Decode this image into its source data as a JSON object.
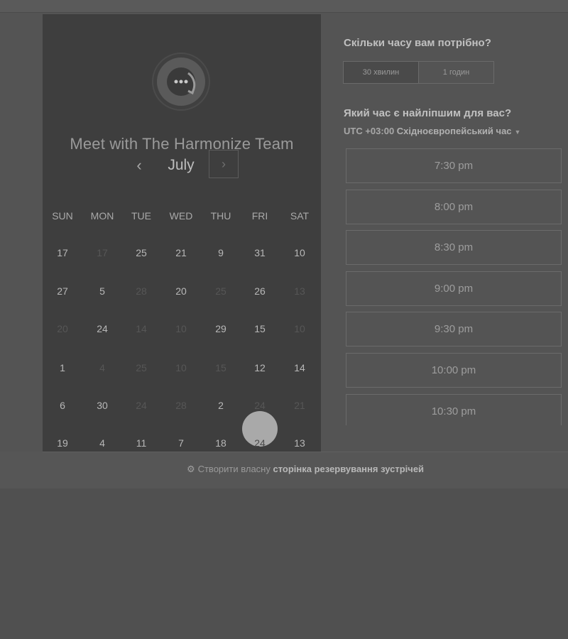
{
  "calendar": {
    "title": "Meet with The Harmonize Team",
    "month": "July",
    "prev_icon": "‹",
    "next_icon": "›",
    "weekdays": [
      "SUN",
      "MON",
      "TUE",
      "WED",
      "THU",
      "FRI",
      "SAT"
    ],
    "weeks": [
      [
        {
          "d": "17",
          "s": "avail"
        },
        {
          "d": "17",
          "s": "dim"
        },
        {
          "d": "25",
          "s": "avail"
        },
        {
          "d": "21",
          "s": "avail"
        },
        {
          "d": "9",
          "s": "avail"
        },
        {
          "d": "31",
          "s": "avail"
        },
        {
          "d": "10",
          "s": "avail"
        }
      ],
      [
        {
          "d": "27",
          "s": "avail"
        },
        {
          "d": "5",
          "s": "avail"
        },
        {
          "d": "28",
          "s": "dim"
        },
        {
          "d": "20",
          "s": "avail"
        },
        {
          "d": "25",
          "s": "dim"
        },
        {
          "d": "26",
          "s": "avail"
        },
        {
          "d": "13",
          "s": "dim"
        }
      ],
      [
        {
          "d": "20",
          "s": "dim"
        },
        {
          "d": "24",
          "s": "avail"
        },
        {
          "d": "14",
          "s": "dim"
        },
        {
          "d": "10",
          "s": "dim"
        },
        {
          "d": "29",
          "s": "avail"
        },
        {
          "d": "15",
          "s": "avail"
        },
        {
          "d": "10",
          "s": "dim"
        }
      ],
      [
        {
          "d": "1",
          "s": "avail"
        },
        {
          "d": "4",
          "s": "dim"
        },
        {
          "d": "25",
          "s": "dim"
        },
        {
          "d": "10",
          "s": "dim"
        },
        {
          "d": "15",
          "s": "dim"
        },
        {
          "d": "12",
          "s": "avail"
        },
        {
          "d": "14",
          "s": "avail"
        }
      ],
      [
        {
          "d": "6",
          "s": "avail"
        },
        {
          "d": "30",
          "s": "avail"
        },
        {
          "d": "24",
          "s": "dim"
        },
        {
          "d": "28",
          "s": "dim"
        },
        {
          "d": "2",
          "s": "avail"
        },
        {
          "d": "24",
          "s": "dim"
        },
        {
          "d": "21",
          "s": "dim"
        }
      ],
      [
        {
          "d": "19",
          "s": "avail"
        },
        {
          "d": "4",
          "s": "avail"
        },
        {
          "d": "11",
          "s": "avail"
        },
        {
          "d": "7",
          "s": "avail"
        },
        {
          "d": "18",
          "s": "avail"
        },
        {
          "d": "24",
          "s": "selected"
        },
        {
          "d": "13",
          "s": "avail"
        }
      ]
    ]
  },
  "booking": {
    "duration_question": "Скільки часу вам потрібно?",
    "durations": [
      {
        "label": "30 хвилин",
        "active": true
      },
      {
        "label": "1 годин",
        "active": false
      }
    ],
    "time_question": "Який час є найліпшим для вас?",
    "tz_prefix": "UTC +03:00",
    "tz_name": "Східноєвропейський час",
    "times": [
      "7:30 pm",
      "8:00 pm",
      "8:30 pm",
      "9:00 pm",
      "9:30 pm",
      "10:00 pm",
      "10:30 pm"
    ]
  },
  "footer": {
    "prefix": "Створити власну",
    "link": "сторінка резервування зустрічей"
  }
}
